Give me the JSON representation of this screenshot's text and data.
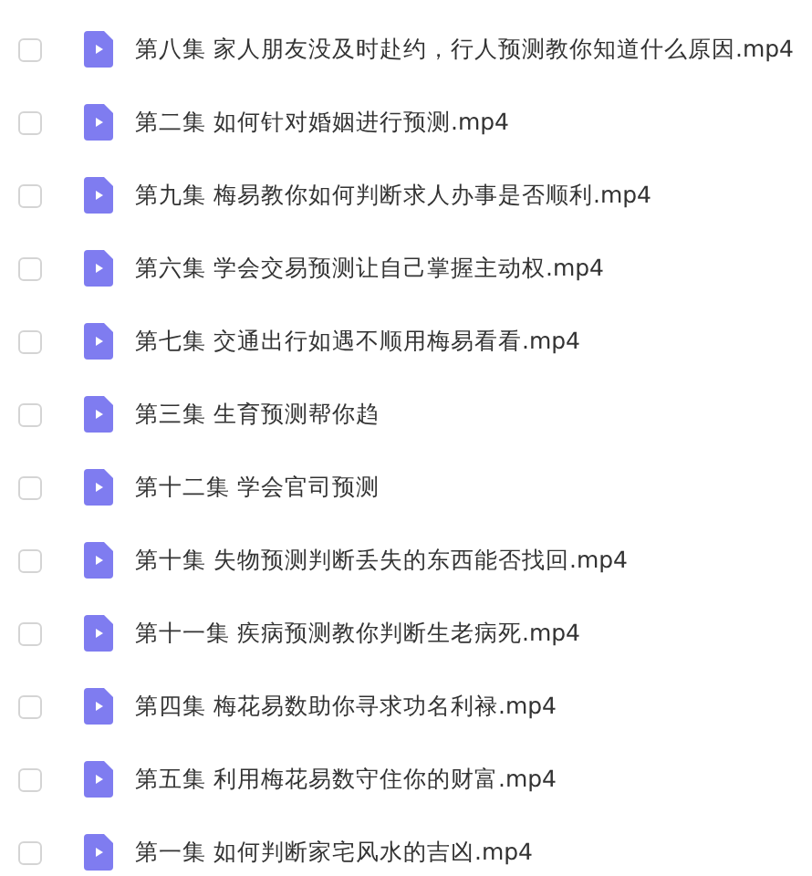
{
  "files": [
    {
      "name": "第八集 家人朋友没及时赴约，行人预测教你知道什么原因.mp4",
      "checked": false
    },
    {
      "name": "第二集 如何针对婚姻进行预测.mp4",
      "checked": false
    },
    {
      "name": "第九集 梅易教你如何判断求人办事是否顺利.mp4",
      "checked": false
    },
    {
      "name": "第六集 学会交易预测让自己掌握主动权.mp4",
      "checked": false
    },
    {
      "name": "第七集 交通出行如遇不顺用梅易看看.mp4",
      "checked": false
    },
    {
      "name": "第三集 生育预测帮你趋",
      "checked": false
    },
    {
      "name": "第十二集 学会官司预测",
      "checked": false
    },
    {
      "name": "第十集 失物预测判断丢失的东西能否找回.mp4",
      "checked": false
    },
    {
      "name": "第十一集  疾病预测教你判断生老病死.mp4",
      "checked": false
    },
    {
      "name": "第四集  梅花易数助你寻求功名利禄.mp4",
      "checked": false
    },
    {
      "name": "第五集 利用梅花易数守住你的财富.mp4",
      "checked": false
    },
    {
      "name": "第一集 如何判断家宅风水的吉凶.mp4",
      "checked": false
    }
  ]
}
